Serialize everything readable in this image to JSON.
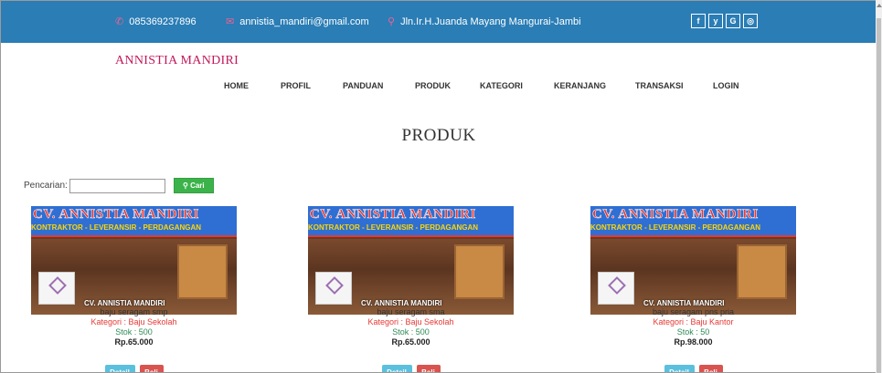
{
  "topbar": {
    "phone": "085369237896",
    "email": "annistia_mandiri@gmail.com",
    "address": "Jln.Ir.H.Juanda Mayang Mangurai-Jambi",
    "social": [
      "f",
      "y",
      "G",
      "◎"
    ],
    "icons": [
      "phone-icon",
      "envelope-icon",
      "map-marker-icon"
    ],
    "color": "#2a7db5"
  },
  "brand": "ANNISTIA MANDIRI",
  "nav": [
    "HOME",
    "PROFIL",
    "PANDUAN",
    "PRODUK",
    "KATEGORI",
    "KERANJANG",
    "TRANSAKSI",
    "LOGIN"
  ],
  "page_title": "PRODUK",
  "search": {
    "label": "Pencarian:",
    "value": "",
    "button": "Cari",
    "button_icon": "search-icon"
  },
  "banner": {
    "title": "CV. ANNISTIA MANDIRI",
    "subtitle": "KONTRAKTOR - LEVERANSIR - PERDAGANGAN",
    "footer": "CV. ANNISTIA MANDIRI"
  },
  "products": [
    {
      "name": "baju seragam smp",
      "category": "Kategori : Baju Sekolah",
      "stock": "Stok : 500",
      "price": "Rp.65.000",
      "detail": "Detail",
      "buy": "Beli"
    },
    {
      "name": "baju seragam sma",
      "category": "Kategori : Baju Sekolah",
      "stock": "Stok : 500",
      "price": "Rp.65.000",
      "detail": "Detail",
      "buy": "Beli"
    },
    {
      "name": "baju seragam pns pria",
      "category": "Kategori : Baju Kantor",
      "stock": "Stok : 50",
      "price": "Rp.98.000",
      "detail": "Detail",
      "buy": "Beli"
    }
  ]
}
